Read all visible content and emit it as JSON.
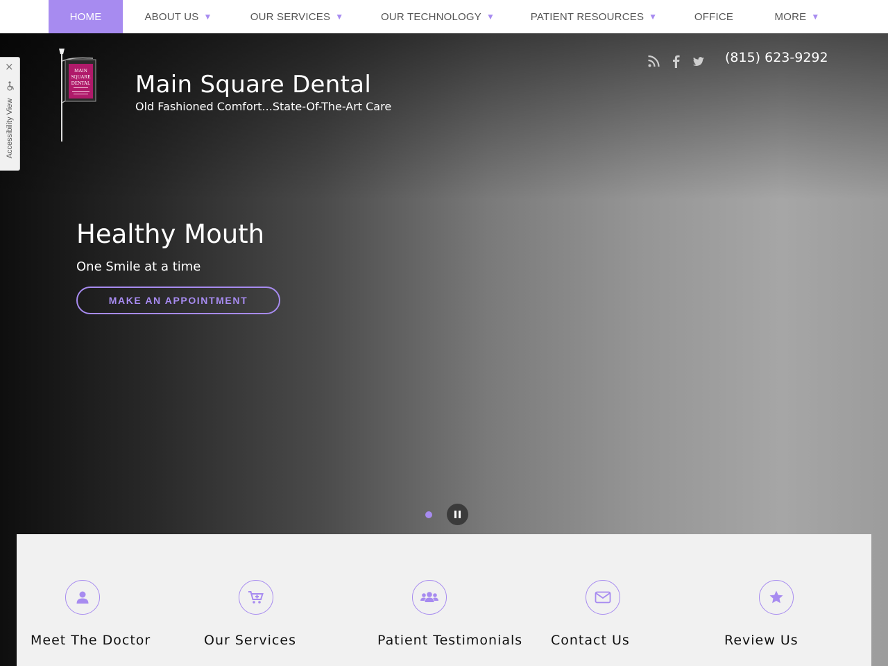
{
  "nav": {
    "items": [
      {
        "label": "HOME",
        "active": true,
        "has_dropdown": false
      },
      {
        "label": "ABOUT US",
        "active": false,
        "has_dropdown": true
      },
      {
        "label": "OUR SERVICES",
        "active": false,
        "has_dropdown": true
      },
      {
        "label": "OUR TECHNOLOGY",
        "active": false,
        "has_dropdown": true
      },
      {
        "label": "PATIENT RESOURCES",
        "active": false,
        "has_dropdown": true
      },
      {
        "label": "OFFICE",
        "active": false,
        "has_dropdown": false
      },
      {
        "label": "MORE",
        "active": false,
        "has_dropdown": true
      }
    ],
    "caret_glyph": "▼",
    "active_color": "#a78bf0"
  },
  "accessibility": {
    "label": "Accessibility View",
    "close_glyph": "×"
  },
  "brand": {
    "title": "Main Square Dental",
    "tagline": "Old Fashioned Comfort...State-Of-The-Art Care",
    "logo_text": [
      "MAIN",
      "SQUARE",
      "DENTAL"
    ]
  },
  "header": {
    "social_icons": [
      "rss-icon",
      "facebook-icon",
      "twitter-icon"
    ],
    "phone": "(815) 623-9292"
  },
  "slide": {
    "title": "Healthy Mouth",
    "subtitle": "One Smile at a time",
    "cta_label": "MAKE AN APPOINTMENT"
  },
  "slider_controls": {
    "pause_icon": "pause-icon",
    "active_dot_color": "#a78bf0"
  },
  "features": [
    {
      "label": "Meet The Doctor",
      "icon": "user-icon"
    },
    {
      "label": "Our Services",
      "icon": "cart-plus-icon"
    },
    {
      "label": "Patient Testimonials",
      "icon": "group-icon"
    },
    {
      "label": "Contact Us",
      "icon": "envelope-icon"
    },
    {
      "label": "Review Us",
      "icon": "star-icon"
    }
  ],
  "colors": {
    "accent": "#a78bf0",
    "logo_banner": "#b01a6a",
    "panel_bg": "#f1f1f1"
  }
}
